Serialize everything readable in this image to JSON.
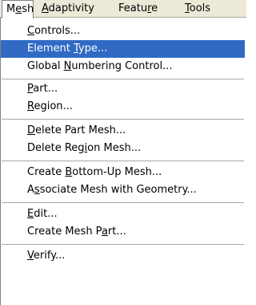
{
  "menubar": {
    "items": [
      {
        "pre": "M",
        "key": "e",
        "post": "sh"
      },
      {
        "pre": "",
        "key": "A",
        "post": "daptivity"
      },
      {
        "pre": "Featu",
        "key": "r",
        "post": "e"
      },
      {
        "pre": "",
        "key": "T",
        "post": "ools"
      }
    ]
  },
  "menu": {
    "items": [
      {
        "pre": "",
        "key": "C",
        "post": "ontrols..."
      },
      {
        "pre": "Element ",
        "key": "T",
        "post": "ype..."
      },
      {
        "pre": "Global ",
        "key": "N",
        "post": "umbering Control..."
      },
      {
        "pre": "",
        "key": "P",
        "post": "art..."
      },
      {
        "pre": "",
        "key": "R",
        "post": "egion..."
      },
      {
        "pre": "",
        "key": "D",
        "post": "elete Part Mesh..."
      },
      {
        "pre": "Delete Reg",
        "key": "i",
        "post": "on Mesh..."
      },
      {
        "pre": "Create ",
        "key": "B",
        "post": "ottom-Up Mesh..."
      },
      {
        "pre": "A",
        "key": "s",
        "post": "sociate Mesh with Geometry..."
      },
      {
        "pre": "",
        "key": "E",
        "post": "dit..."
      },
      {
        "pre": "Create Mesh P",
        "key": "a",
        "post": "rt..."
      },
      {
        "pre": "",
        "key": "V",
        "post": "erify..."
      }
    ]
  }
}
